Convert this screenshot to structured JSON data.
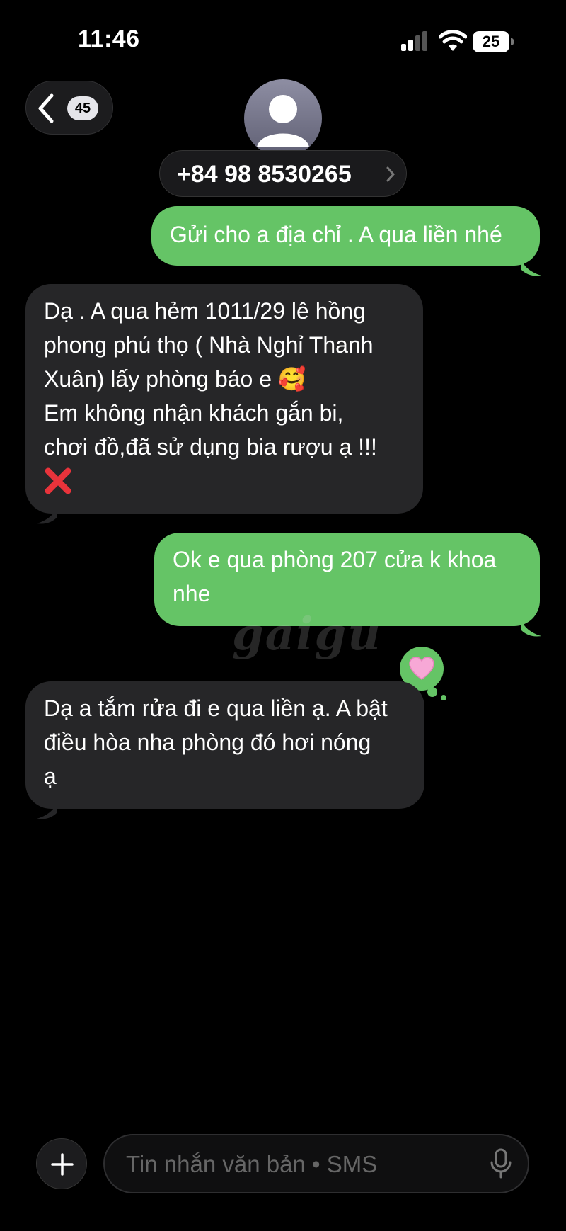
{
  "status_bar": {
    "time": "11:46",
    "battery": "25"
  },
  "header": {
    "back_count": "45",
    "contact_number": "+84 98 8530265"
  },
  "messages": [
    {
      "type": "sent",
      "lines": [
        "Gửi cho a địa chỉ . A qua liền nhé"
      ]
    },
    {
      "type": "received",
      "lines": [
        "Dạ . A qua hẻm 1011/29 lê hồng",
        "phong phú thọ ( Nhà Nghỉ Thanh",
        "Xuân) lấy phòng báo e 🥰",
        "Em không nhận khách gắn bi,",
        "chơi đồ,đã sử dụng bia rượu ạ !!!"
      ]
    },
    {
      "type": "sent",
      "lines": [
        "Ok e qua phòng 207 cửa k khoa",
        "nhe"
      ]
    },
    {
      "type": "received",
      "lines": [
        "Dạ a tắm rửa đi e qua liền ạ. A bật",
        "điều hòa nha phòng đó hơi nóng",
        "ạ"
      ]
    }
  ],
  "watermark": "gaigu",
  "composer": {
    "placeholder": "Tin nhắn văn bản • SMS"
  },
  "colors": {
    "sent_bubble": "#65c466",
    "received_bubble": "#262628",
    "background": "#000000"
  }
}
